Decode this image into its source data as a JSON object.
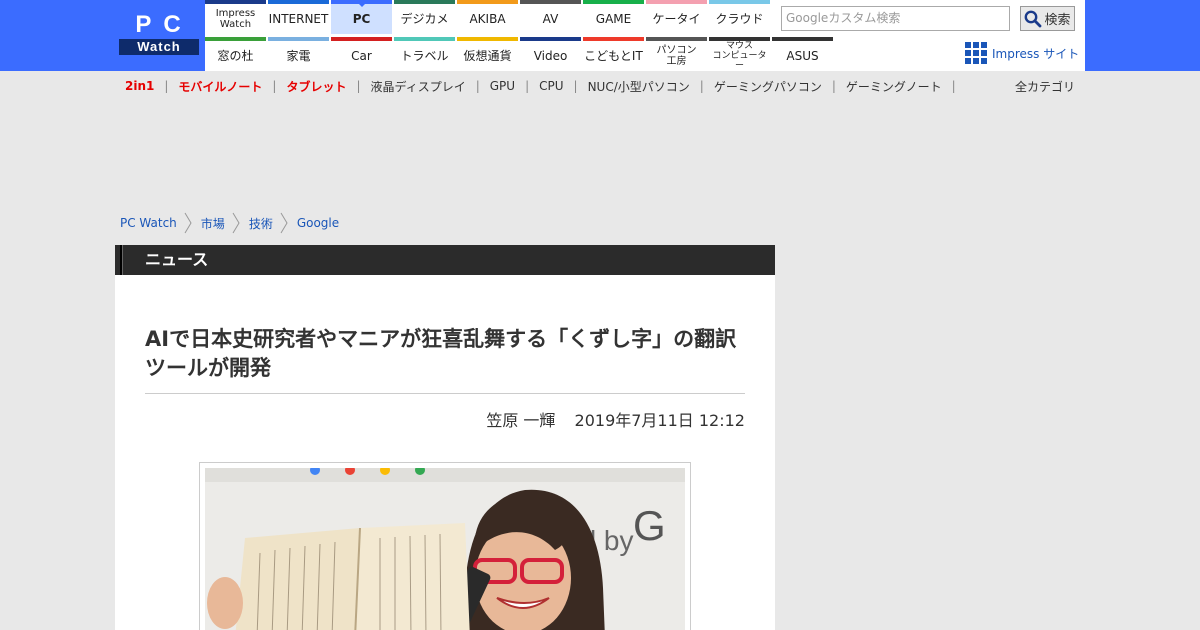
{
  "logo": {
    "line1": "PC",
    "line2": "Watch"
  },
  "nav": {
    "top": [
      {
        "label": "Impress Watch",
        "color": "#1a3a8a"
      },
      {
        "label": "INTERNET",
        "color": "#1a6ad8"
      },
      {
        "label": "PC",
        "color": "#3b6cff",
        "active": true
      },
      {
        "label": "デジカメ",
        "color": "#2a7a5a"
      },
      {
        "label": "AKIBA",
        "color": "#f29a1a"
      },
      {
        "label": "AV",
        "color": "#555555"
      },
      {
        "label": "GAME",
        "color": "#18b04a"
      },
      {
        "label": "ケータイ",
        "color": "#f4a0b0"
      },
      {
        "label": "クラウド",
        "color": "#79c8e8"
      }
    ],
    "bottom": [
      {
        "label": "窓の杜",
        "color": "#3aa03a"
      },
      {
        "label": "家電",
        "color": "#7ab0e0"
      },
      {
        "label": "Car",
        "color": "#d42020"
      },
      {
        "label": "トラベル",
        "color": "#50c8b8"
      },
      {
        "label": "仮想通貨",
        "color": "#f0b800"
      },
      {
        "label": "Video",
        "color": "#1a3a8a"
      },
      {
        "label": "こどもとIT",
        "color": "#ee3a2a"
      },
      {
        "label": "パソコン\n工房",
        "color": "#555555"
      },
      {
        "label": "マウス\nコンピューター",
        "color": "#333333"
      },
      {
        "label": "ASUS",
        "color": "#333333"
      }
    ]
  },
  "search": {
    "placeholder": "Googleカスタム検索",
    "button_label": "検索"
  },
  "impress_site_label": "Impress サイト",
  "categories": [
    {
      "label": "2in1",
      "highlight": true
    },
    {
      "label": "モバイルノート",
      "highlight": true
    },
    {
      "label": "タブレット",
      "highlight": true
    },
    {
      "label": "液晶ディスプレイ",
      "highlight": false
    },
    {
      "label": "GPU",
      "highlight": false
    },
    {
      "label": "CPU",
      "highlight": false
    },
    {
      "label": "NUC/小型パソコン",
      "highlight": false
    },
    {
      "label": "ゲーミングパソコン",
      "highlight": false
    },
    {
      "label": "ゲーミングノート",
      "highlight": false
    }
  ],
  "all_categories_label": "全カテゴリ",
  "breadcrumb": [
    "PC Watch",
    "市場",
    "技術",
    "Google"
  ],
  "article": {
    "section": "ニュース",
    "title": "AIで日本史研究者やマニアが狂喜乱舞する「くずし字」の翻訳ツールが開発",
    "author": "笠原 一輝",
    "date": "2019年7月11日 12:12"
  }
}
